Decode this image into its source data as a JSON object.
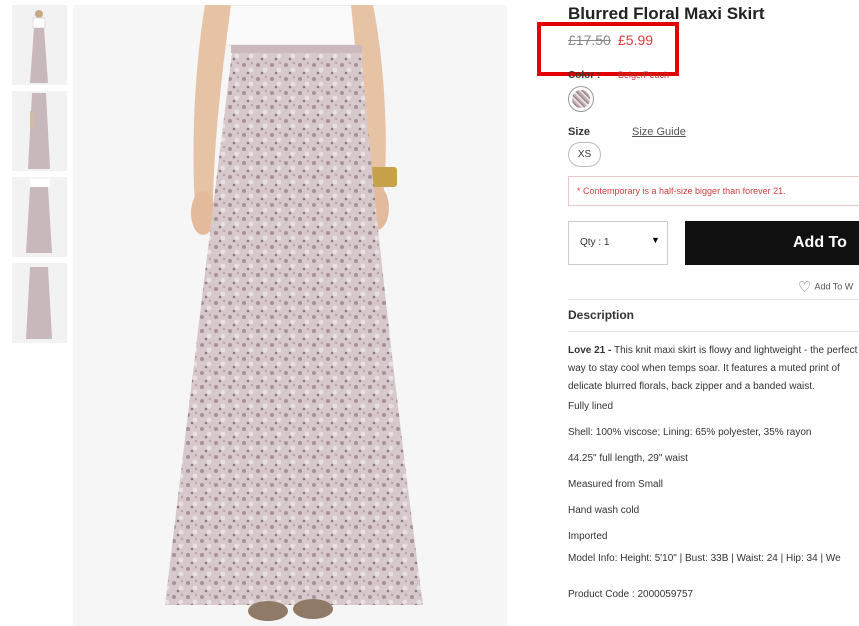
{
  "product": {
    "title": "Blurred Floral Maxi Skirt",
    "price_old": "£17.50",
    "price_new": "£5.99",
    "color_label": "Color :",
    "color_value": "Beige/Peach",
    "size_label": "Size",
    "size_guide": "Size Guide",
    "sizes": [
      "XS"
    ],
    "note": "* Contemporary is a half-size bigger than forever 21.",
    "qty_label": "Qty : 1",
    "add_button": "Add To",
    "wishlist": "Add To W"
  },
  "description": {
    "heading": "Description",
    "brand": "Love 21 -",
    "text": "This knit maxi skirt is flowy and lightweight - the perfect way to stay cool when temps soar. It features a muted print of delicate blurred florals, back zipper and a banded waist.",
    "lines": [
      "Fully lined",
      "Shell: 100% viscose; Lining: 65% polyester, 35% rayon",
      "44.25\" full length, 29\" waist",
      "Measured from Small",
      "Hand wash cold",
      "Imported",
      "Model Info: Height: 5'10\" | Bust: 33B | Waist: 24 | Hip: 34 | We"
    ],
    "product_code": "Product Code : 2000059757"
  },
  "colors": {
    "price_sale": "#e03a3a",
    "highlight": "#e30000",
    "button": "#111111",
    "skirt": "#c9b8bb"
  },
  "icons": [
    "heart-icon",
    "caret-down-icon"
  ]
}
